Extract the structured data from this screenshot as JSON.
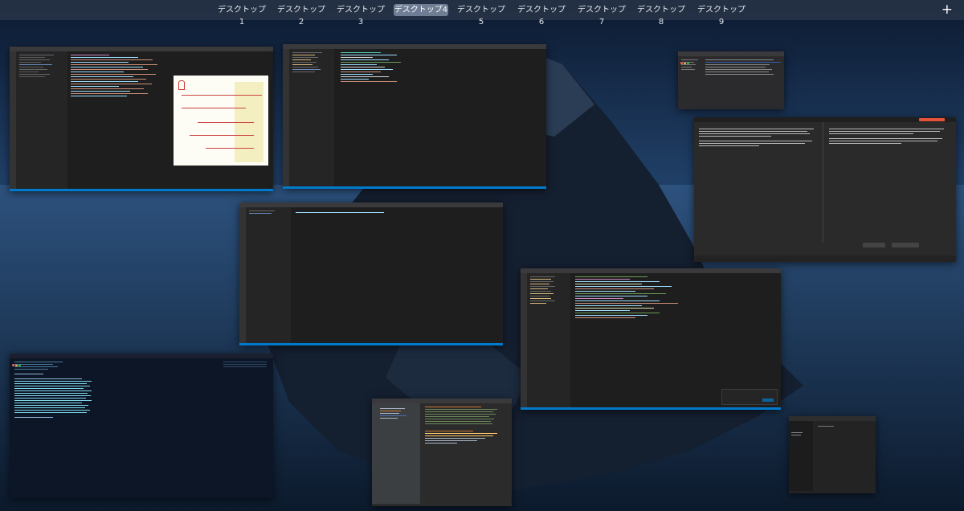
{
  "mission_control": {
    "spaces": [
      {
        "label": "デスクトップ1",
        "active": false
      },
      {
        "label": "デスクトップ2",
        "active": false
      },
      {
        "label": "デスクトップ3",
        "active": false
      },
      {
        "label": "デスクトップ4",
        "active": true
      },
      {
        "label": "デスクトップ5",
        "active": false
      },
      {
        "label": "デスクトップ6",
        "active": false
      },
      {
        "label": "デスクトップ7",
        "active": false
      },
      {
        "label": "デスクトップ8",
        "active": false
      },
      {
        "label": "デスクトップ9",
        "active": false
      }
    ],
    "add_space_label": "+"
  },
  "colors": {
    "accent": "#007acc",
    "active_space": "#6f7e94",
    "editor_bg": "#1e1e1e",
    "sidebar_bg": "#252526",
    "terminal_bg": "#0d1626"
  },
  "windows": [
    {
      "name": "vscode-window-sequence-diagram",
      "kind": "editor"
    },
    {
      "name": "vscode-window-markdown",
      "kind": "editor"
    },
    {
      "name": "finder-window",
      "kind": "finder"
    },
    {
      "name": "translator-window",
      "kind": "dialog"
    },
    {
      "name": "vscode-window-small",
      "kind": "editor"
    },
    {
      "name": "vscode-window-large",
      "kind": "editor"
    },
    {
      "name": "terminal-window",
      "kind": "terminal"
    },
    {
      "name": "intellij-window",
      "kind": "editor"
    },
    {
      "name": "notes-window",
      "kind": "notes"
    }
  ]
}
